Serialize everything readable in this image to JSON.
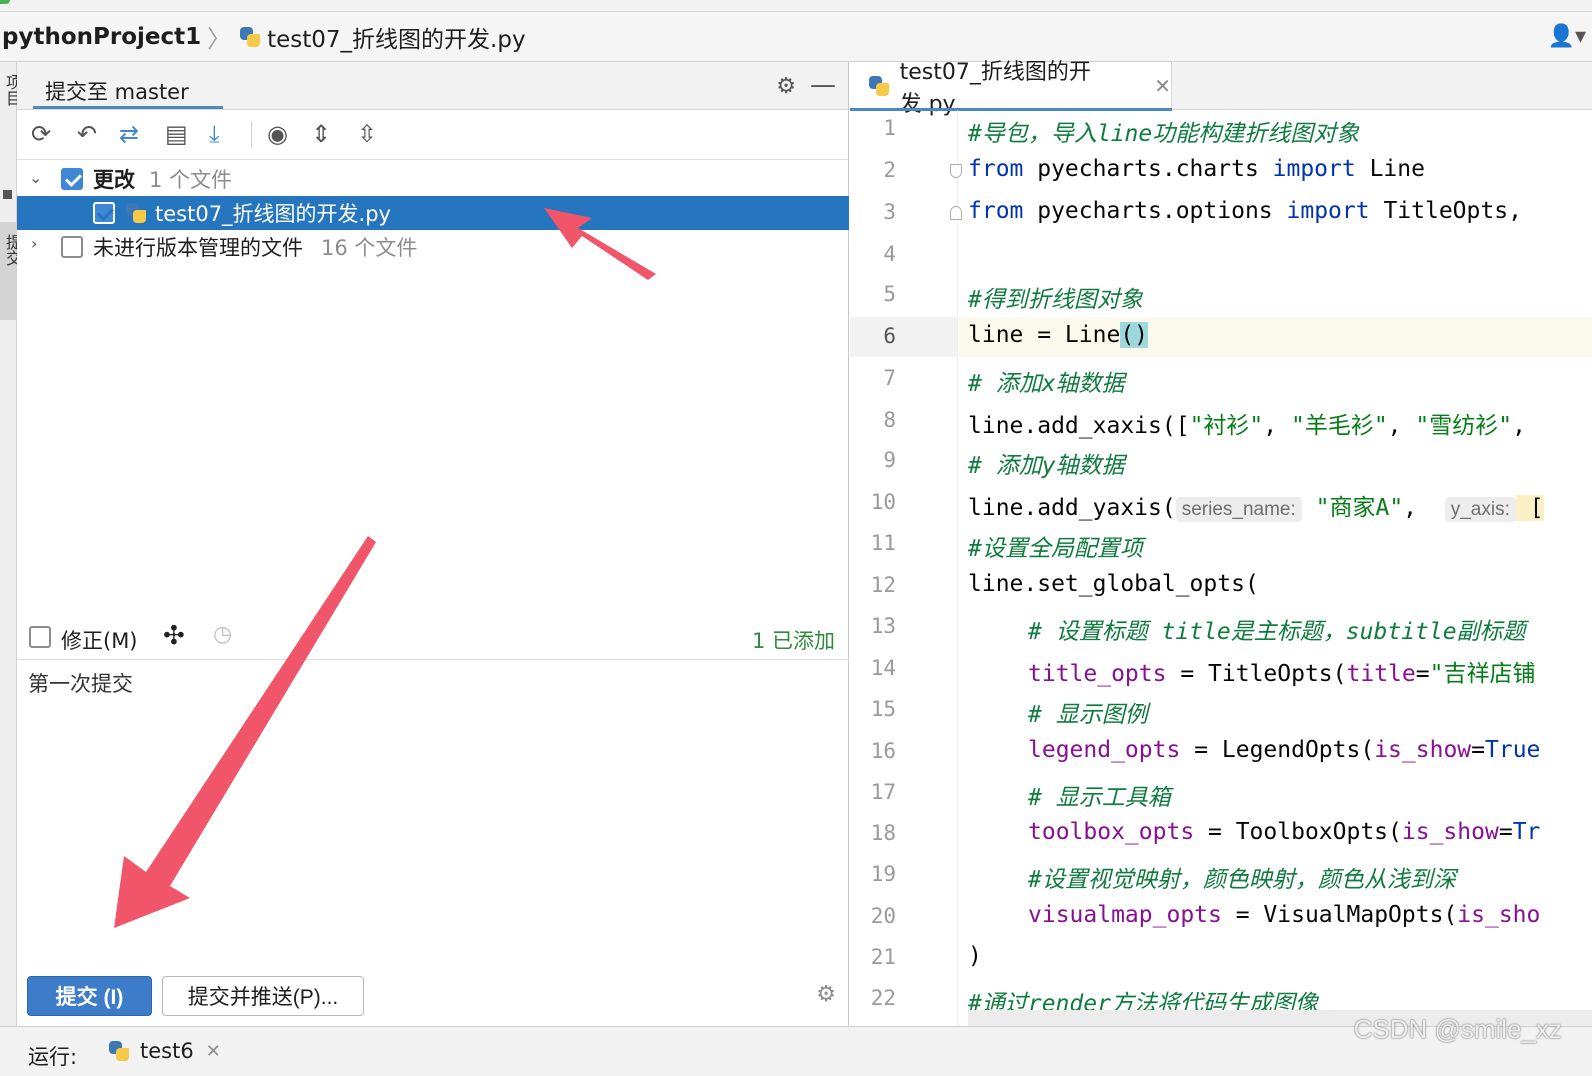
{
  "breadcrumb": {
    "project": "pythonProject1",
    "file": "test07_折线图的开发.py"
  },
  "gutter": {
    "tab_top": "项目",
    "tab_commit": "提交"
  },
  "commit_panel": {
    "title": "提交至 master",
    "changes": {
      "label": "更改",
      "count": "1 个文件",
      "files": [
        {
          "name": "test07_折线图的开发.py",
          "checked": true
        }
      ]
    },
    "unversioned": {
      "label": "未进行版本管理的文件",
      "count": "16 个文件"
    },
    "amend_label": "修正(M)",
    "added_status": "1 已添加",
    "commit_message": "第一次提交",
    "commit_button": "提交 (I)",
    "commit_push_button": "提交并推送(P)..."
  },
  "editor": {
    "tab_label": "test07_折线图的开发.py",
    "line_numbers": [
      "1",
      "2",
      "3",
      "4",
      "5",
      "6",
      "7",
      "8",
      "9",
      "10",
      "11",
      "12",
      "13",
      "14",
      "15",
      "16",
      "17",
      "18",
      "19",
      "20",
      "21",
      "22"
    ],
    "current_line": "6",
    "code": {
      "l1": "#导包，导入line功能构建折线图对象",
      "l2_from": "from",
      "l2_mod": " pyecharts.charts ",
      "l2_import": "import",
      "l2_name": " Line",
      "l3_from": "from",
      "l3_mod": " pyecharts.options ",
      "l3_import": "import",
      "l3_name": " TitleOpts,",
      "l5": "#得到折线图对象",
      "l6_a": "line = Line",
      "l6_b": "()",
      "l7": "# 添加x轴数据",
      "l8_a": "line.add_xaxis([",
      "l8_s1": "\"衬衫\"",
      "l8_c1": ", ",
      "l8_s2": "\"羊毛衫\"",
      "l8_c2": ", ",
      "l8_s3": "\"雪纺衫\"",
      "l8_c3": ",",
      "l9": "# 添加y轴数据",
      "l10_a": "line.add_yaxis(",
      "l10_hint1": "series_name:",
      "l10_s1": " \"商家A\"",
      "l10_c1": ",  ",
      "l10_hint2": "y_axis:",
      "l10_b": " [",
      "l11": "#设置全局配置项",
      "l12": "line.set_global_opts(",
      "l13": "# 设置标题 title是主标题，subtitle副标题",
      "l14_p": "title_opts",
      "l14_a": " = TitleOpts(",
      "l14_p2": "title",
      "l14_b": "=",
      "l14_s": "\"吉祥店铺",
      "l15": "# 显示图例",
      "l16_p": "legend_opts",
      "l16_a": " = LegendOpts(",
      "l16_p2": "is_show",
      "l16_b": "=",
      "l16_k": "True",
      "l17": "# 显示工具箱",
      "l18_p": "toolbox_opts",
      "l18_a": " = ToolboxOpts(",
      "l18_p2": "is_show",
      "l18_b": "=",
      "l18_k": "Tr",
      "l19": "#设置视觉映射，颜色映射，颜色从浅到深",
      "l20_p": "visualmap_opts",
      "l20_a": " = VisualMapOpts(",
      "l20_p2": "is_sho",
      "l21": ")",
      "l22": "#通过render方法将代码生成图像"
    }
  },
  "bottom": {
    "run_label": "运行:",
    "run_tab": "test6"
  },
  "watermark": "CSDN @smile_xz",
  "colors": {
    "selection": "#2675bf",
    "accent": "#4a88c7",
    "commit_button": "#3d7cc9",
    "arrow": "#f0556a",
    "keyword": "#0033b3",
    "string": "#067d17",
    "param": "#871094"
  }
}
